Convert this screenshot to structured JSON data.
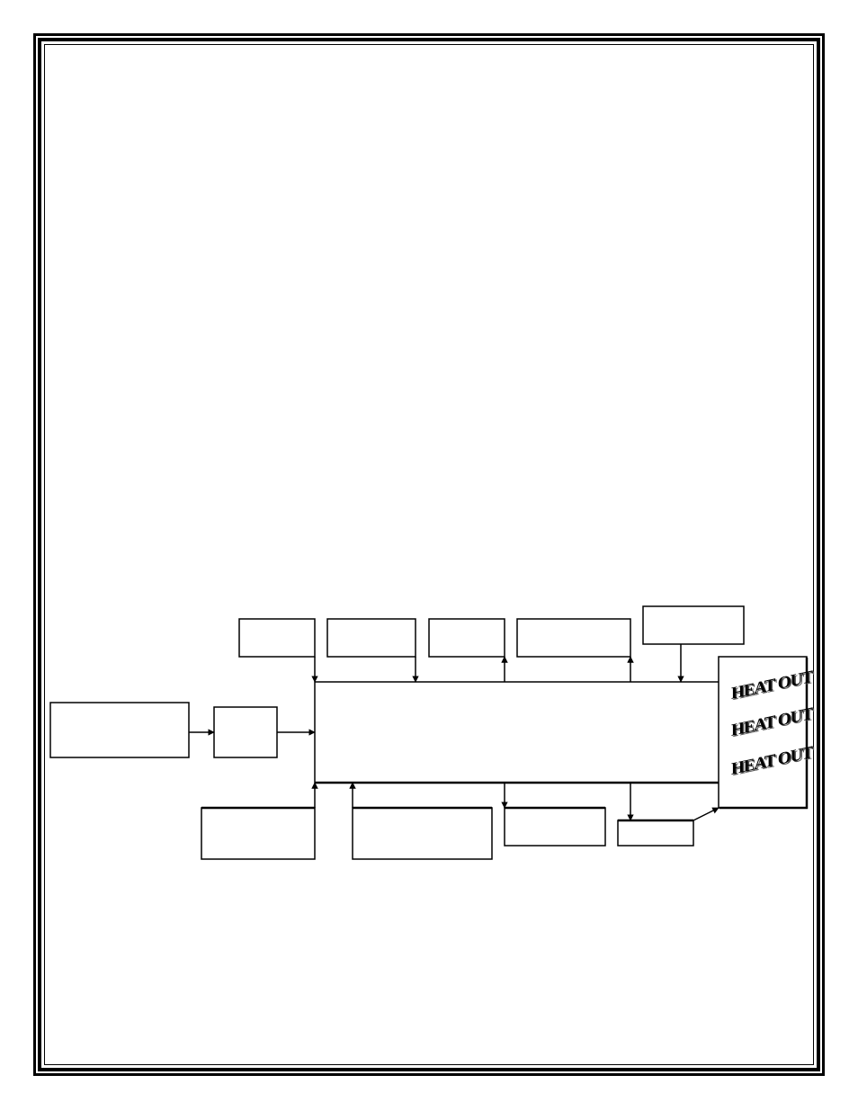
{
  "diagram": {
    "title": "",
    "boxes": {
      "top": [
        {
          "id": "top-box-1",
          "label": ""
        },
        {
          "id": "top-box-2",
          "label": ""
        },
        {
          "id": "top-box-3",
          "label": ""
        },
        {
          "id": "top-box-4",
          "label": ""
        },
        {
          "id": "top-box-5",
          "label": ""
        }
      ],
      "left": [
        {
          "id": "source-box",
          "label": ""
        },
        {
          "id": "intermediate-box",
          "label": ""
        }
      ],
      "main": {
        "id": "process-block",
        "label": ""
      },
      "bottom": [
        {
          "id": "bottom-box-1",
          "label": ""
        },
        {
          "id": "bottom-box-2",
          "label": ""
        },
        {
          "id": "bottom-box-3",
          "label": ""
        },
        {
          "id": "bottom-box-4",
          "label": ""
        }
      ]
    },
    "heat_out": {
      "labels": [
        "HEAT OUT",
        "HEAT OUT",
        "HEAT OUT"
      ]
    },
    "connections": [
      {
        "from": "source-box",
        "to": "intermediate-box",
        "direction": "right"
      },
      {
        "from": "intermediate-box",
        "to": "process-block",
        "direction": "right"
      },
      {
        "from": "top-box-1",
        "to": "process-block",
        "direction": "down"
      },
      {
        "from": "top-box-2",
        "to": "process-block",
        "direction": "down"
      },
      {
        "from": "process-block",
        "to": "top-box-3",
        "direction": "up"
      },
      {
        "from": "process-block",
        "to": "top-box-4",
        "direction": "up"
      },
      {
        "from": "top-box-5",
        "to": "process-block",
        "direction": "down"
      },
      {
        "from": "bottom-box-1",
        "to": "process-block",
        "direction": "up"
      },
      {
        "from": "bottom-box-2",
        "to": "process-block",
        "direction": "up"
      },
      {
        "from": "process-block",
        "to": "bottom-box-3",
        "direction": "down"
      },
      {
        "from": "process-block",
        "to": "bottom-box-4",
        "direction": "down"
      },
      {
        "from": "bottom-box-4",
        "to": "heat-out-box",
        "direction": "diagonal"
      }
    ]
  }
}
